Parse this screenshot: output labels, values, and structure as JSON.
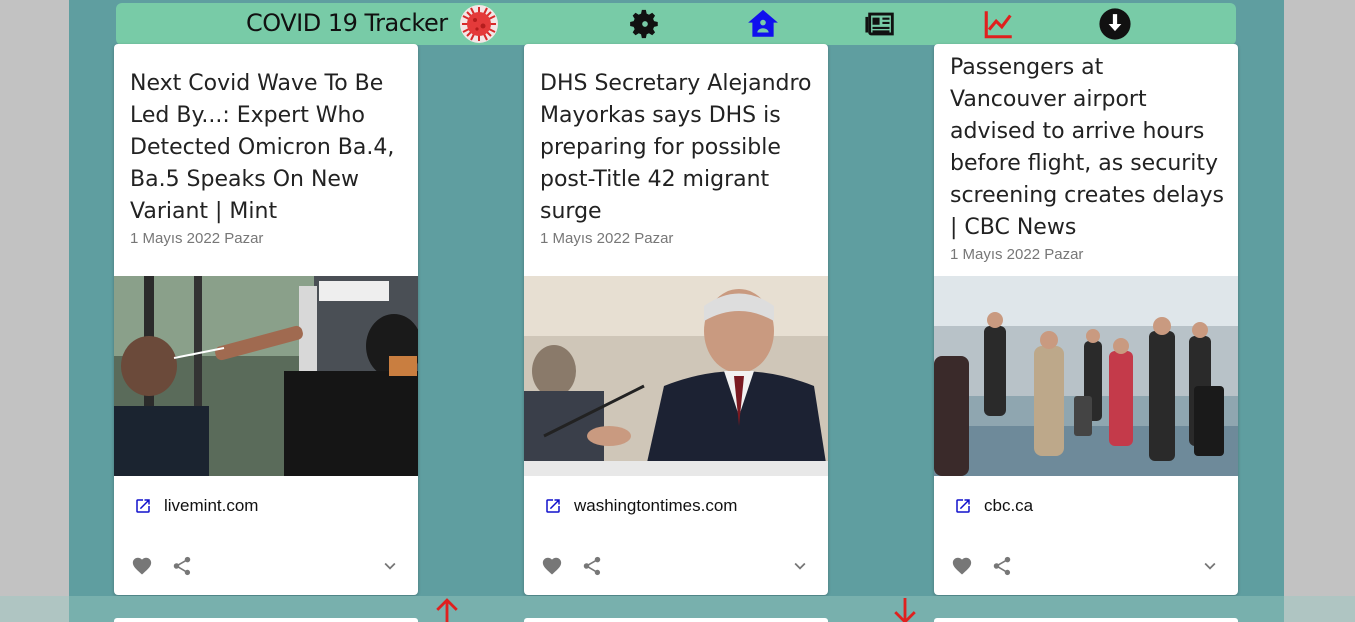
{
  "app": {
    "title": "COVID 19 Tracker"
  },
  "nav": {
    "icons": [
      "settings-gear-icon",
      "home-icon",
      "newspaper-icon",
      "trending-chart-icon",
      "download-circle-icon"
    ],
    "colors": {
      "bar": "#78cba7",
      "home": "#1010ee",
      "chart": "#e0201e",
      "dark": "#111111"
    }
  },
  "cards": [
    {
      "title": "Next Covid Wave To Be Led By...: Expert Who Detected Omicron Ba.4, Ba.5 Speaks On New Variant | Mint",
      "date": "1 Mayıs 2022 Pazar",
      "source": "livemint.com"
    },
    {
      "title": "DHS Secretary Alejandro Mayorkas says DHS is preparing for possible post-Title 42 migrant surge",
      "date": "1 Mayıs 2022 Pazar",
      "source": "washingtontimes.com"
    },
    {
      "title": "Passengers at Vancouver airport advised to arrive hours before flight, as security screening creates delays | CBC News",
      "date": "1 Mayıs 2022 Pazar",
      "source": "cbc.ca"
    }
  ],
  "pager": {
    "up_icon": "arrow-up-icon",
    "down_icon": "arrow-down-icon",
    "arrow_color": "#e0201e"
  }
}
